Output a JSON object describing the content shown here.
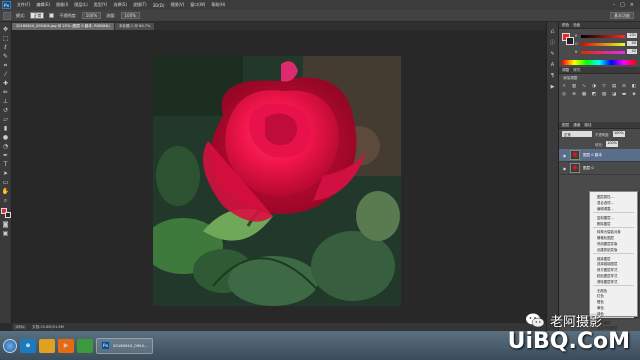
{
  "app": {
    "logo": "Ps",
    "menu": [
      "文件(F)",
      "编辑(E)",
      "图像(I)",
      "图层(L)",
      "类型(Y)",
      "选择(S)",
      "滤镜(T)",
      "3D(D)",
      "视图(V)",
      "窗口(W)",
      "帮助(H)"
    ],
    "window_controls": [
      "-",
      "□",
      "×"
    ]
  },
  "options_bar": {
    "mode_select": "正常",
    "labels": [
      "模式:",
      "不透明度:",
      "流量:"
    ],
    "workspace": "基本功能"
  },
  "document": {
    "tab_active": "20160610_095404.jpg @ 25% (图层 0 副本, RGB/8#)",
    "tab_other": "未标题-1 @ 66.7%"
  },
  "status": {
    "zoom": "25%",
    "doc_info": "文档:25.8M/51.6M"
  },
  "panels": {
    "color_tab": "颜色",
    "swatches_tab": "色板",
    "sliders": [
      {
        "label": "R",
        "value": "231",
        "color": "#e42a2a"
      },
      {
        "label": "G",
        "value": "40",
        "color": "#3a3"
      },
      {
        "label": "B",
        "value": "42",
        "color": "#33a"
      }
    ],
    "adjust_tab": "调整",
    "styles_tab": "样式",
    "add_adjustment": "添加调整",
    "layers_tab": "图层",
    "channels_tab": "通道",
    "paths_tab": "路径",
    "blend_mode": "正常",
    "opacity_label": "不透明度:",
    "opacity": "100%",
    "fill_label": "填充:",
    "fill": "100%",
    "layers": [
      {
        "name": "图层 0 副本",
        "selected": true
      },
      {
        "name": "图层 0",
        "selected": false
      }
    ]
  },
  "context_menu": {
    "items": [
      "图层属性...",
      "混合选项...",
      "编辑调整...",
      "复制图层...",
      "删除图层",
      "转换为智能对象",
      "栅格化图层",
      "停用图层蒙版",
      "创建剪贴蒙版",
      "链接图层",
      "选择链接图层",
      "拷贝图层样式",
      "粘贴图层样式",
      "清除图层样式",
      "无颜色",
      "红色",
      "橙色",
      "黄色",
      "绿色",
      "合并图层",
      "合并可见图层",
      "拼合图像"
    ]
  },
  "taskbar": {
    "ps_task": "20160610_0954..."
  },
  "watermark": {
    "account": "老阿摄影",
    "site": "UiBQ.CoM"
  }
}
